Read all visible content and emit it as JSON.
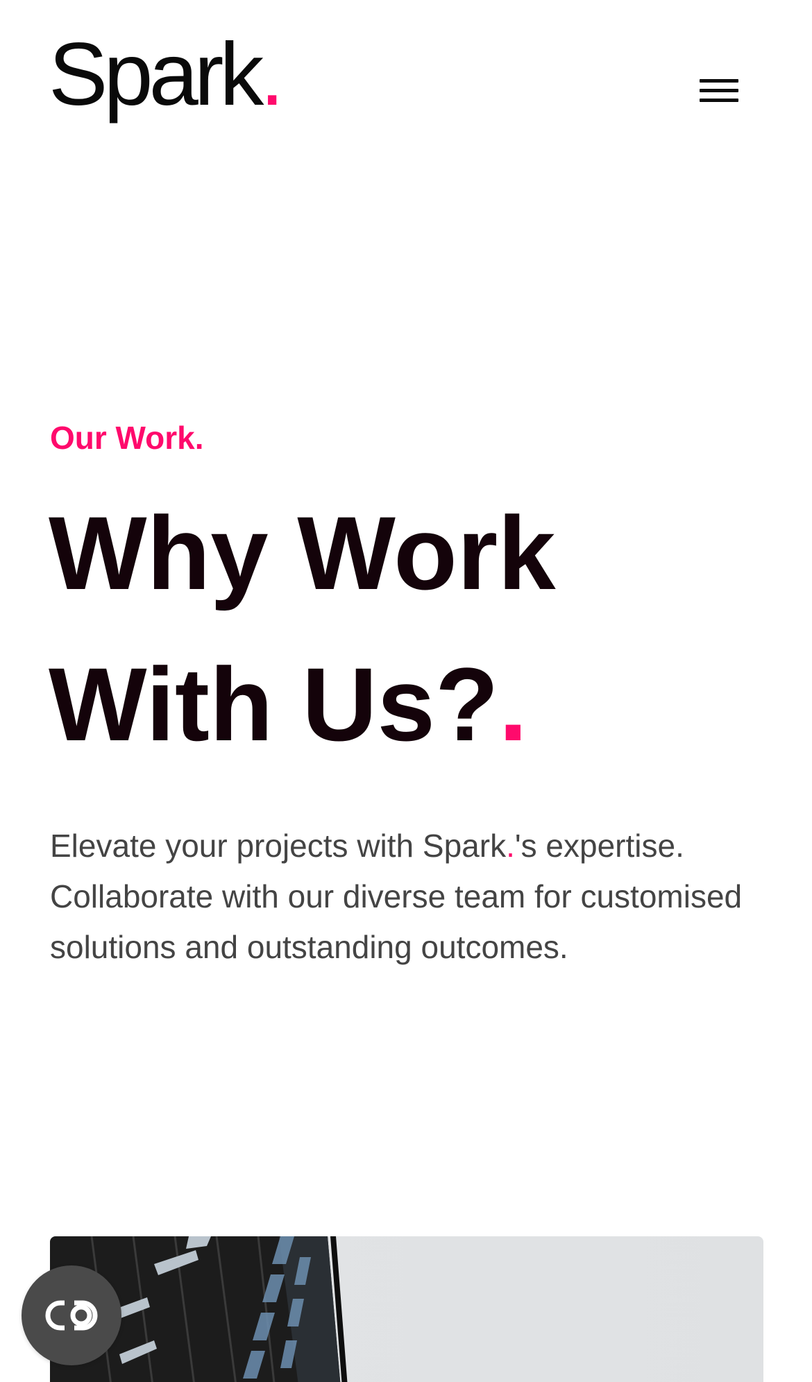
{
  "header": {
    "logo_text": "Spark",
    "logo_dot": ".",
    "menu_icon": "hamburger-menu-icon"
  },
  "hero": {
    "eyebrow": "Our Work.",
    "headline_line1": "Why Work",
    "headline_line2": "With Us?",
    "headline_dot": ".",
    "intro_part1": "Elevate your projects with Spark",
    "intro_dot": ".",
    "intro_part2": "'s expertise. Collaborate with our diverse team for customised solutions and outstanding outcomes."
  },
  "floating_button": {
    "icon": "accessibility-toggle-icon"
  },
  "colors": {
    "accent": "#ff0a6c",
    "heading": "#14030a",
    "body_text": "#444444",
    "fab_background": "#4a4a4a"
  }
}
